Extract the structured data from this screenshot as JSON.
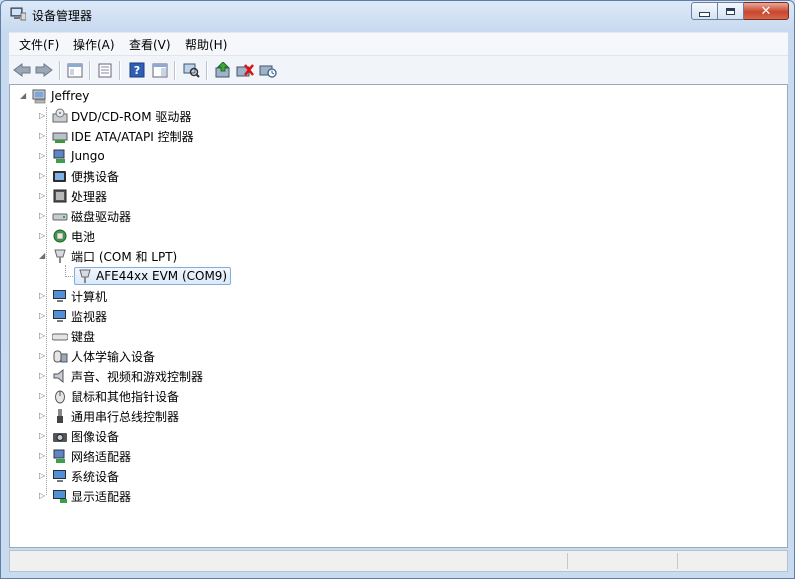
{
  "window": {
    "title": "设备管理器"
  },
  "menu": [
    "文件(F)",
    "操作(A)",
    "查看(V)",
    "帮助(H)"
  ],
  "toolbar": [
    "back-icon",
    "forward-icon",
    "show-hide-console-tree-icon",
    "properties-icon",
    "help-icon",
    "action-pane-icon",
    "scan-hardware-icon",
    "update-driver-icon",
    "uninstall-icon",
    "disable-icon"
  ],
  "tree": {
    "root": "Jeffrey",
    "categories": [
      {
        "label": "DVD/CD-ROM 驱动器",
        "icon": "dvd-drive-icon"
      },
      {
        "label": "IDE ATA/ATAPI 控制器",
        "icon": "ide-controller-icon"
      },
      {
        "label": "Jungo",
        "icon": "jungo-icon"
      },
      {
        "label": "便携设备",
        "icon": "portable-device-icon"
      },
      {
        "label": "处理器",
        "icon": "processor-icon"
      },
      {
        "label": "磁盘驱动器",
        "icon": "disk-drive-icon"
      },
      {
        "label": "电池",
        "icon": "battery-icon"
      },
      {
        "label": "端口 (COM 和 LPT)",
        "icon": "port-icon",
        "expanded": true,
        "children": [
          {
            "label": "AFE44xx EVM (COM9)",
            "icon": "serial-port-icon",
            "selected": true
          }
        ]
      },
      {
        "label": "计算机",
        "icon": "computer-icon"
      },
      {
        "label": "监视器",
        "icon": "monitor-icon"
      },
      {
        "label": "键盘",
        "icon": "keyboard-icon"
      },
      {
        "label": "人体学输入设备",
        "icon": "hid-icon"
      },
      {
        "label": "声音、视频和游戏控制器",
        "icon": "sound-icon"
      },
      {
        "label": "鼠标和其他指针设备",
        "icon": "mouse-icon"
      },
      {
        "label": "通用串行总线控制器",
        "icon": "usb-icon"
      },
      {
        "label": "图像设备",
        "icon": "imaging-device-icon"
      },
      {
        "label": "网络适配器",
        "icon": "network-adapter-icon"
      },
      {
        "label": "系统设备",
        "icon": "system-device-icon"
      },
      {
        "label": "显示适配器",
        "icon": "display-adapter-icon"
      }
    ]
  },
  "status": {
    "text": ""
  }
}
